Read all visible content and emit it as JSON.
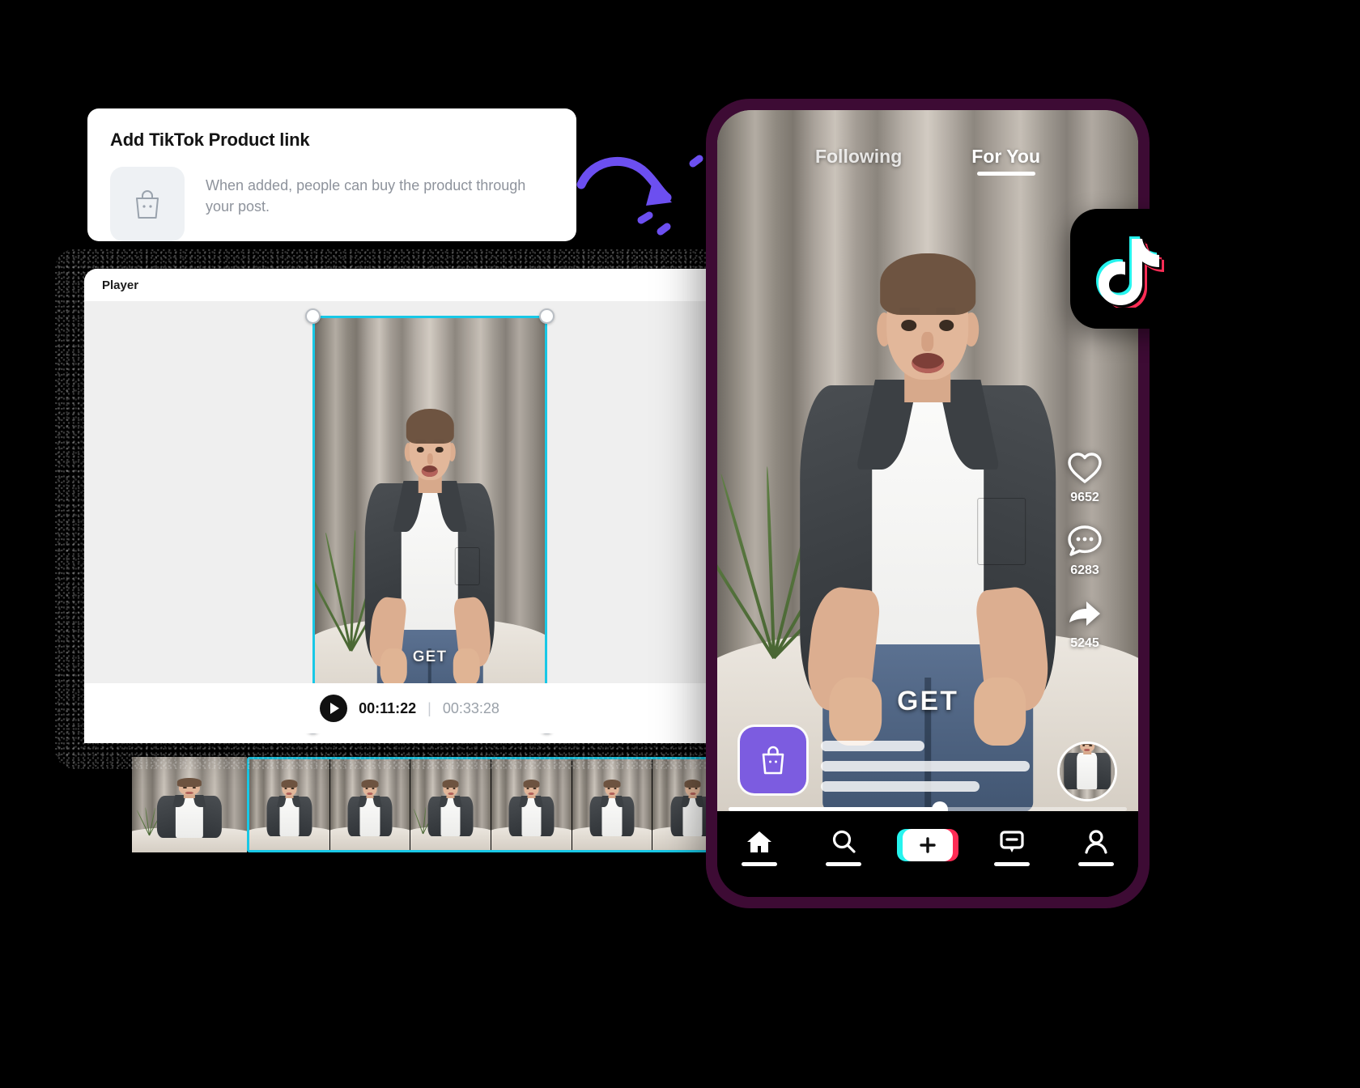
{
  "product_card": {
    "title": "Add TikTok Product link",
    "description": "When added, people can buy the product through your post.",
    "icon": "shopping-bag-icon"
  },
  "annotation": {
    "icon": "curved-arrow-icon",
    "color": "#6c4ff0"
  },
  "player": {
    "window_title": "Player",
    "selection_color": "#18c8e6",
    "transport": {
      "play_icon": "play-icon",
      "current_time": "00:11:22",
      "separator": "|",
      "total_time": "00:33:28"
    },
    "video_overlay_text": "GET",
    "timeline": {
      "frame_count": 6
    }
  },
  "phone": {
    "shell_color": "#3d0b34",
    "feed_tabs": [
      {
        "label": "Following",
        "active": false
      },
      {
        "label": "For You",
        "active": true
      }
    ],
    "video_overlay_text": "GET",
    "actions": [
      {
        "icon": "heart-icon",
        "count": "9652"
      },
      {
        "icon": "comment-icon",
        "count": "6283"
      },
      {
        "icon": "share-icon",
        "count": "5245"
      }
    ],
    "shop_button": {
      "icon": "shopping-bag-icon",
      "color": "#7c5ce0"
    },
    "avatar": "creator-avatar",
    "progress": {
      "percent": 53
    },
    "bottom_nav": [
      {
        "icon": "home-icon"
      },
      {
        "icon": "search-icon"
      },
      {
        "icon": "create-plus-icon"
      },
      {
        "icon": "inbox-icon"
      },
      {
        "icon": "profile-icon"
      }
    ]
  },
  "tiktok_badge": {
    "icon": "tiktok-logo-icon",
    "accent_cyan": "#25f4ee",
    "accent_pink": "#fe2c55"
  }
}
